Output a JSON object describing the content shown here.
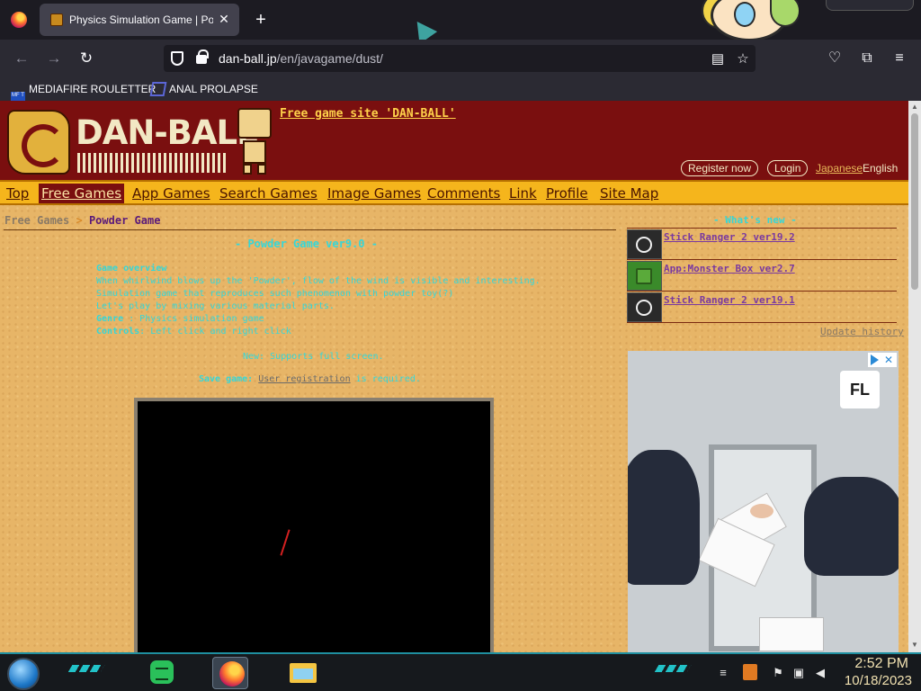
{
  "browser": {
    "tab": {
      "title": "Physics Simulation Game | Powder Game",
      "close_glyph": "✕"
    },
    "new_tab_glyph": "+",
    "nav": {
      "back_glyph": "←",
      "forward_glyph": "→",
      "reload_glyph": "↻"
    },
    "url": {
      "host": "dan-ball.jp",
      "path": "/en/javagame/dust/"
    },
    "url_icons": {
      "reader_glyph": "▤",
      "star_glyph": "☆"
    },
    "toolbar_icons": {
      "pocket_glyph": "♡",
      "extensions_glyph": "⧉",
      "menu_glyph": "≡"
    },
    "bookmarks": [
      {
        "label": "MEDIAFIRE ROULETTER",
        "icon": "mediafire-icon",
        "icon_text": "MF T"
      },
      {
        "label": "ANAL PROLAPSE",
        "icon": "sigma-icon"
      }
    ]
  },
  "site": {
    "logo_text": "DAN-BALL",
    "tagline": "Free game site 'DAN-BALL'",
    "register_label": "Register now",
    "login_label": "Login",
    "lang_japanese": "Japanese",
    "lang_english": "English",
    "menu": [
      "Top",
      "Free Games",
      "App Games",
      "Search Games",
      "Image Games",
      "Comments",
      "Link",
      "Profile",
      "Site Map"
    ],
    "active_menu": "Free Games",
    "breadcrumb": {
      "parent": "Free Games",
      "separator": ">",
      "current": "Powder Game"
    },
    "game_title": "- Powder Game ver9.0 -",
    "overview": {
      "heading": "Game overview",
      "lines": [
        "When whirlwind blows up the 'Powder', flow of the wind is visible and interesting.",
        "Simulation game that reproduces such phenomenon with powder toy(?)",
        "Let's play by mixing various material parts."
      ],
      "genre_label": "Genre",
      "genre_value": ": Physics simulation game",
      "controls_label": "Controls",
      "controls_value": ": Left click and right click"
    },
    "new_note": "New: Supports full screen.",
    "save_note": {
      "label": "Save game:",
      "link": "User registration",
      "suffix": "is required."
    },
    "sidebar": {
      "title": "- What's new -",
      "news": [
        {
          "label": "Stick Ranger 2 ver19.2",
          "icon": "stick-ranger-icon"
        },
        {
          "label": "App:Monster Box ver2.7",
          "icon": "monster-box-icon"
        },
        {
          "label": "Stick Ranger 2 ver19.1",
          "icon": "stick-ranger-icon"
        }
      ],
      "update_history": "Update history"
    },
    "ad": {
      "logo_text": "FL",
      "close_glyph": "✕"
    }
  },
  "taskbar": {
    "clock_time": "2:52 PM",
    "clock_date": "10/18/2023",
    "apps": [
      "notes-app-icon",
      "firefox-icon",
      "file-explorer-icon"
    ]
  },
  "colors": {
    "header_red": "#7a0f0f",
    "menu_yellow": "#f5b51c",
    "cyan_text": "#35d7d9",
    "page_tan": "#e7b567",
    "link_purple": "#7a3aa0"
  }
}
